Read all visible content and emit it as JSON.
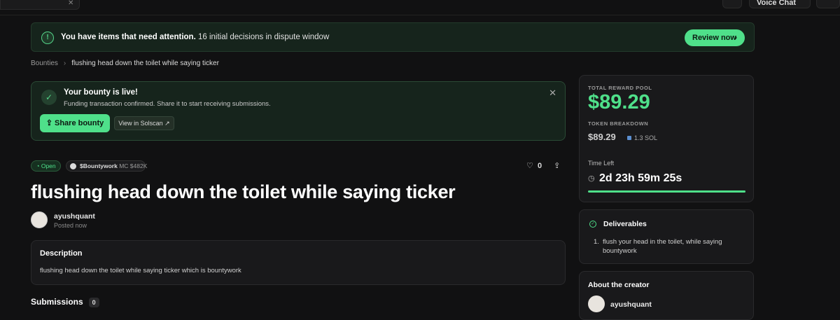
{
  "topbar": {
    "voice_chat": "Voice Chat"
  },
  "alert": {
    "bold": "You have items that need attention.",
    "text": " 16 initial decisions in dispute window",
    "button": "Review now"
  },
  "breadcrumb": {
    "root": "Bounties",
    "current": "flushing head down the toilet while saying ticker"
  },
  "live": {
    "title": "Your bounty is live!",
    "subtitle": "Funding transaction confirmed. Share it to start receiving submissions.",
    "share": "Share bounty",
    "solscan": "View in Solscan"
  },
  "bounty": {
    "status": "Open",
    "token": "$Bountywork",
    "mc": "MC $482K",
    "comments": "0",
    "title": "flushing head down the toilet while saying ticker",
    "author": "ayushquant",
    "posted": "Posted now",
    "description_label": "Description",
    "description": "flushing head down the toilet while saying ticker which is bountywork",
    "submissions_label": "Submissions",
    "submissions_count": "0"
  },
  "reward": {
    "pool_label": "TOTAL REWARD POOL",
    "amount": "$89.29",
    "breakdown_label": "TOKEN BREAKDOWN",
    "token_amount": "$89.29",
    "sol": "1.3 SOL",
    "time_label": "Time Left",
    "time": "2d 23h 59m 25s",
    "time_progress": 1.0
  },
  "deliverables": {
    "title": "Deliverables",
    "items": [
      "flush your head in the toilet, while saying bountywork"
    ]
  },
  "creator": {
    "title": "About the creator",
    "name": "ayushquant"
  },
  "colors": {
    "accent": "#4fe08a",
    "background": "#111112",
    "card": "#19191b"
  }
}
